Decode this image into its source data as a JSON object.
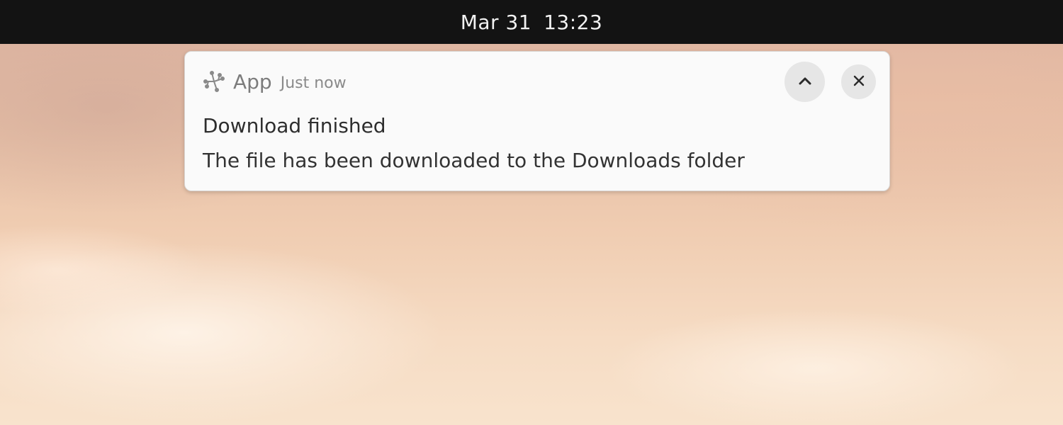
{
  "topbar": {
    "date": "Mar 31",
    "time": "13:23"
  },
  "notification": {
    "app_name": "App",
    "app_icon": "app-icon",
    "timestamp": "Just now",
    "title": "Download finished",
    "body": "The file has been downloaded to the Downloads folder",
    "expand_icon": "chevron-up-icon",
    "close_icon": "close-icon"
  },
  "colors": {
    "topbar_bg": "#131313",
    "card_bg": "#fafafa",
    "button_bg": "#e6e6e6"
  }
}
